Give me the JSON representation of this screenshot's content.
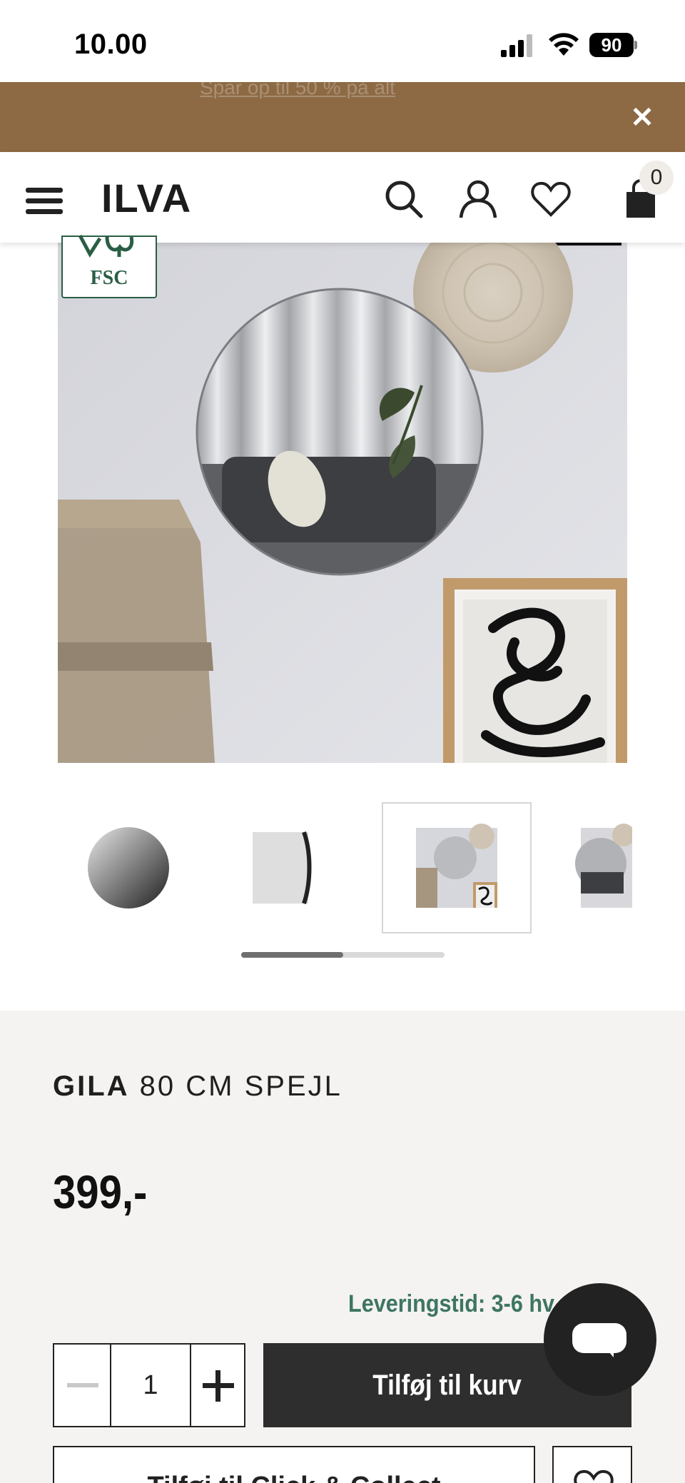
{
  "status_bar": {
    "time": "10.00",
    "battery": "90"
  },
  "promo": {
    "text": "Spar op til 50 % på alt",
    "close_icon": "close-icon"
  },
  "header": {
    "logo": "ILVA",
    "cart_count": "0",
    "icons": [
      "menu-icon",
      "search-icon",
      "user-icon",
      "heart-icon",
      "shopping-bag-icon"
    ]
  },
  "product": {
    "badge": "FSC",
    "brand": "GILA",
    "name": "80 CM SPEJL",
    "price": "399,-",
    "delivery": "Leveringstid: 3-6 hv",
    "quantity": "1",
    "add_to_cart": "Tilføj til kurv",
    "click_collect": "Tilføj til Click & Collect"
  },
  "gallery": {
    "thumbnails": [
      "Rundt spejl",
      "Spejl set fra siden",
      "Spejl på væg",
      "Spejl i stue"
    ],
    "selected_index": 2,
    "scroll_position": 0.5
  },
  "colors": {
    "promo_bg": "#8d6a44",
    "delivery_text": "#3e7563",
    "primary_button": "#2e2e2e",
    "info_bg": "#f4f3f1"
  }
}
